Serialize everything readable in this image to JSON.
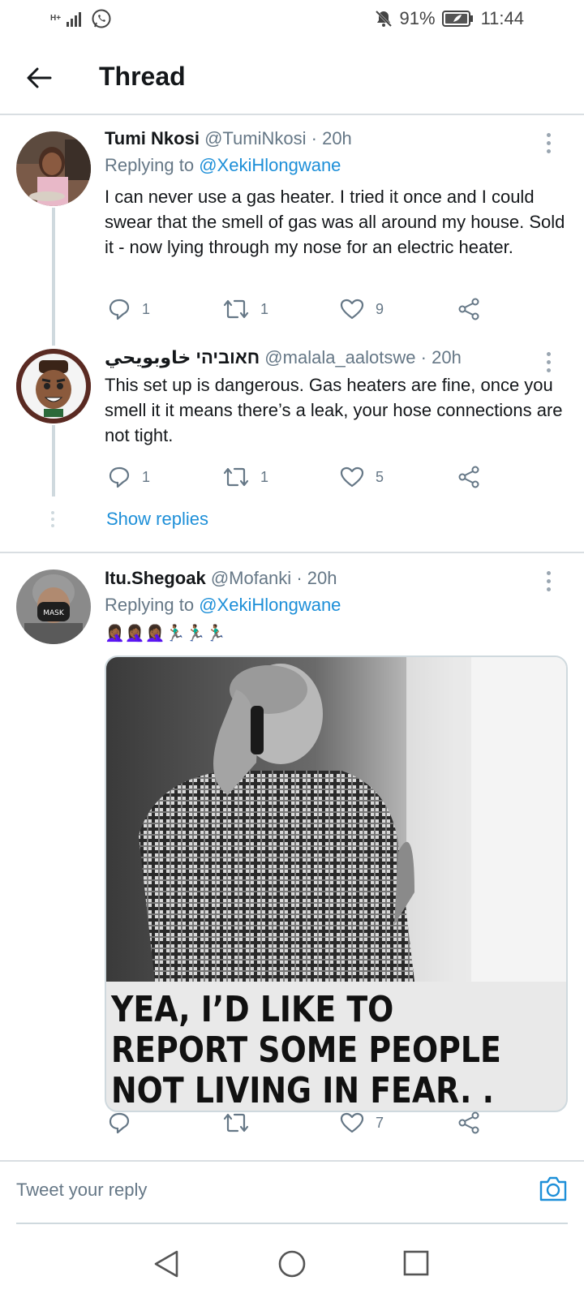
{
  "status_bar": {
    "signal_label": "H+",
    "battery_percent": "91%",
    "time": "11:44"
  },
  "header": {
    "title": "Thread"
  },
  "tweets": [
    {
      "name": "Tumi Nkosi",
      "handle": "@TumiNkosi",
      "separator": "·",
      "time": "20h",
      "replying_prefix": "Replying to",
      "replying_to": "@XekiHlongwane",
      "text": "I can never use a gas heater. I tried it once and I could swear that the smell of gas was all around my house. Sold it - now lying through my nose for an electric heater.",
      "replies": "1",
      "retweets": "1",
      "likes": "9"
    },
    {
      "name": "חאוביהי خاوبويحي",
      "handle": "@malala_aalotswe",
      "separator": "·",
      "time": "20h",
      "text": "This set up is dangerous. Gas heaters are fine, once you smell it it means there’s a leak, your hose connections are not tight.",
      "replies": "1",
      "retweets": "1",
      "likes": "5",
      "show_replies": "Show replies"
    },
    {
      "name": "Itu.Shegoak",
      "handle": "@Mofanki",
      "separator": "·",
      "time": "20h",
      "replying_prefix": "Replying to",
      "replying_to": "@XekiHlongwane",
      "text": "🤦🏾‍♀️🤦🏾‍♀️🤦🏾‍♀️🏃🏾‍♂️🏃🏾‍♂️🏃🏾‍♂️",
      "media_caption": "YEA, I’D LIKE TO REPORT SOME PEOPLE NOT LIVING IN FEAR. . .",
      "likes": "7"
    }
  ],
  "reply_box": {
    "placeholder": "Tweet your reply"
  },
  "colors": {
    "link": "#1d8fd8",
    "muted": "#657786",
    "divider": "#d9dee2"
  }
}
